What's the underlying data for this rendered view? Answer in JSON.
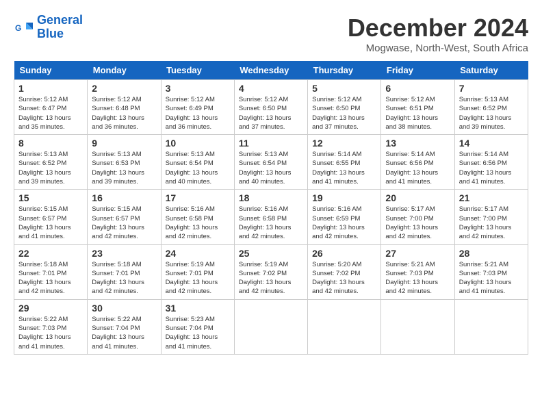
{
  "header": {
    "logo_line1": "General",
    "logo_line2": "Blue",
    "month_title": "December 2024",
    "location": "Mogwase, North-West, South Africa"
  },
  "days_of_week": [
    "Sunday",
    "Monday",
    "Tuesday",
    "Wednesday",
    "Thursday",
    "Friday",
    "Saturday"
  ],
  "weeks": [
    [
      {
        "day": "1",
        "sunrise": "5:12 AM",
        "sunset": "6:47 PM",
        "daylight": "13 hours and 35 minutes."
      },
      {
        "day": "2",
        "sunrise": "5:12 AM",
        "sunset": "6:48 PM",
        "daylight": "13 hours and 36 minutes."
      },
      {
        "day": "3",
        "sunrise": "5:12 AM",
        "sunset": "6:49 PM",
        "daylight": "13 hours and 36 minutes."
      },
      {
        "day": "4",
        "sunrise": "5:12 AM",
        "sunset": "6:50 PM",
        "daylight": "13 hours and 37 minutes."
      },
      {
        "day": "5",
        "sunrise": "5:12 AM",
        "sunset": "6:50 PM",
        "daylight": "13 hours and 37 minutes."
      },
      {
        "day": "6",
        "sunrise": "5:12 AM",
        "sunset": "6:51 PM",
        "daylight": "13 hours and 38 minutes."
      },
      {
        "day": "7",
        "sunrise": "5:13 AM",
        "sunset": "6:52 PM",
        "daylight": "13 hours and 39 minutes."
      }
    ],
    [
      {
        "day": "8",
        "sunrise": "5:13 AM",
        "sunset": "6:52 PM",
        "daylight": "13 hours and 39 minutes."
      },
      {
        "day": "9",
        "sunrise": "5:13 AM",
        "sunset": "6:53 PM",
        "daylight": "13 hours and 39 minutes."
      },
      {
        "day": "10",
        "sunrise": "5:13 AM",
        "sunset": "6:54 PM",
        "daylight": "13 hours and 40 minutes."
      },
      {
        "day": "11",
        "sunrise": "5:13 AM",
        "sunset": "6:54 PM",
        "daylight": "13 hours and 40 minutes."
      },
      {
        "day": "12",
        "sunrise": "5:14 AM",
        "sunset": "6:55 PM",
        "daylight": "13 hours and 41 minutes."
      },
      {
        "day": "13",
        "sunrise": "5:14 AM",
        "sunset": "6:56 PM",
        "daylight": "13 hours and 41 minutes."
      },
      {
        "day": "14",
        "sunrise": "5:14 AM",
        "sunset": "6:56 PM",
        "daylight": "13 hours and 41 minutes."
      }
    ],
    [
      {
        "day": "15",
        "sunrise": "5:15 AM",
        "sunset": "6:57 PM",
        "daylight": "13 hours and 41 minutes."
      },
      {
        "day": "16",
        "sunrise": "5:15 AM",
        "sunset": "6:57 PM",
        "daylight": "13 hours and 42 minutes."
      },
      {
        "day": "17",
        "sunrise": "5:16 AM",
        "sunset": "6:58 PM",
        "daylight": "13 hours and 42 minutes."
      },
      {
        "day": "18",
        "sunrise": "5:16 AM",
        "sunset": "6:58 PM",
        "daylight": "13 hours and 42 minutes."
      },
      {
        "day": "19",
        "sunrise": "5:16 AM",
        "sunset": "6:59 PM",
        "daylight": "13 hours and 42 minutes."
      },
      {
        "day": "20",
        "sunrise": "5:17 AM",
        "sunset": "7:00 PM",
        "daylight": "13 hours and 42 minutes."
      },
      {
        "day": "21",
        "sunrise": "5:17 AM",
        "sunset": "7:00 PM",
        "daylight": "13 hours and 42 minutes."
      }
    ],
    [
      {
        "day": "22",
        "sunrise": "5:18 AM",
        "sunset": "7:01 PM",
        "daylight": "13 hours and 42 minutes."
      },
      {
        "day": "23",
        "sunrise": "5:18 AM",
        "sunset": "7:01 PM",
        "daylight": "13 hours and 42 minutes."
      },
      {
        "day": "24",
        "sunrise": "5:19 AM",
        "sunset": "7:01 PM",
        "daylight": "13 hours and 42 minutes."
      },
      {
        "day": "25",
        "sunrise": "5:19 AM",
        "sunset": "7:02 PM",
        "daylight": "13 hours and 42 minutes."
      },
      {
        "day": "26",
        "sunrise": "5:20 AM",
        "sunset": "7:02 PM",
        "daylight": "13 hours and 42 minutes."
      },
      {
        "day": "27",
        "sunrise": "5:21 AM",
        "sunset": "7:03 PM",
        "daylight": "13 hours and 42 minutes."
      },
      {
        "day": "28",
        "sunrise": "5:21 AM",
        "sunset": "7:03 PM",
        "daylight": "13 hours and 41 minutes."
      }
    ],
    [
      {
        "day": "29",
        "sunrise": "5:22 AM",
        "sunset": "7:03 PM",
        "daylight": "13 hours and 41 minutes."
      },
      {
        "day": "30",
        "sunrise": "5:22 AM",
        "sunset": "7:04 PM",
        "daylight": "13 hours and 41 minutes."
      },
      {
        "day": "31",
        "sunrise": "5:23 AM",
        "sunset": "7:04 PM",
        "daylight": "13 hours and 41 minutes."
      },
      null,
      null,
      null,
      null
    ]
  ]
}
